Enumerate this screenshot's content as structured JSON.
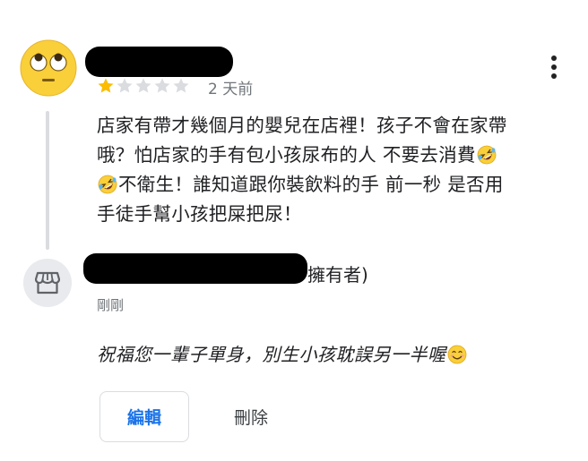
{
  "review": {
    "rating": 1,
    "max_rating": 5,
    "time": "2 天前",
    "lines": [
      "店家有帶才幾個月的嬰兒在店裡！孩子不會在家帶",
      "哦？怕店家的手有包小孩尿布的人 不要去消費",
      "不衛生！誰知道跟你裝飲料的手 前一秒 是否用",
      "手徒手幫小孩把屎把尿！"
    ],
    "avatar_icon": "rolling-eyes-emoji",
    "inline_emoji": "rofl-emoji",
    "star_filled_color": "#fbbc04",
    "star_empty_color": "#dadce0"
  },
  "owner_reply": {
    "role": "擁有者)",
    "time": "剛剛",
    "text": "祝福您一輩子單身，別生小孩耽誤另一半喔",
    "emoji": "smiling-face-emoji",
    "avatar_icon": "storefront-icon"
  },
  "actions": {
    "edit_label": "編輯",
    "delete_label": "刪除"
  },
  "colors": {
    "accent": "#1a73e8",
    "muted": "#70757a"
  }
}
